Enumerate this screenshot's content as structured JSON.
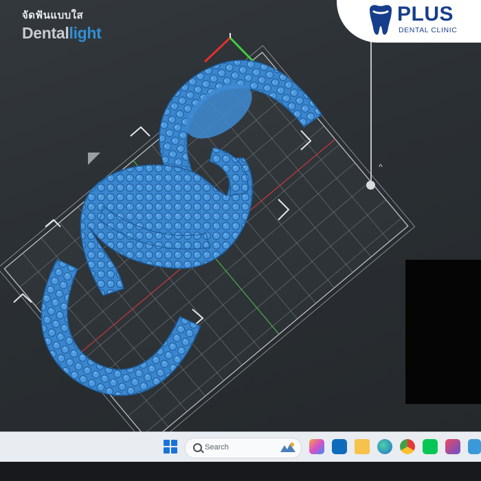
{
  "watermark": {
    "thai_text": "จัดฟันแบบใส",
    "brand_dark": "Dental",
    "brand_light": "light"
  },
  "clinic_logo": {
    "name": "PLUS",
    "subtitle": "DENTAL CLINIC",
    "icon": "tooth-icon",
    "color": "#173e8c"
  },
  "viewport": {
    "model_color": "#3a86cf",
    "background": "#2d3236"
  },
  "taskbar": {
    "search_placeholder": "Search",
    "icons": [
      "windows-start-icon",
      "search-icon",
      "copilot-icon",
      "outlook-icon",
      "file-explorer-icon",
      "edge-icon",
      "chrome-icon",
      "line-icon",
      "slicer-app-icon",
      "app-icon"
    ]
  }
}
